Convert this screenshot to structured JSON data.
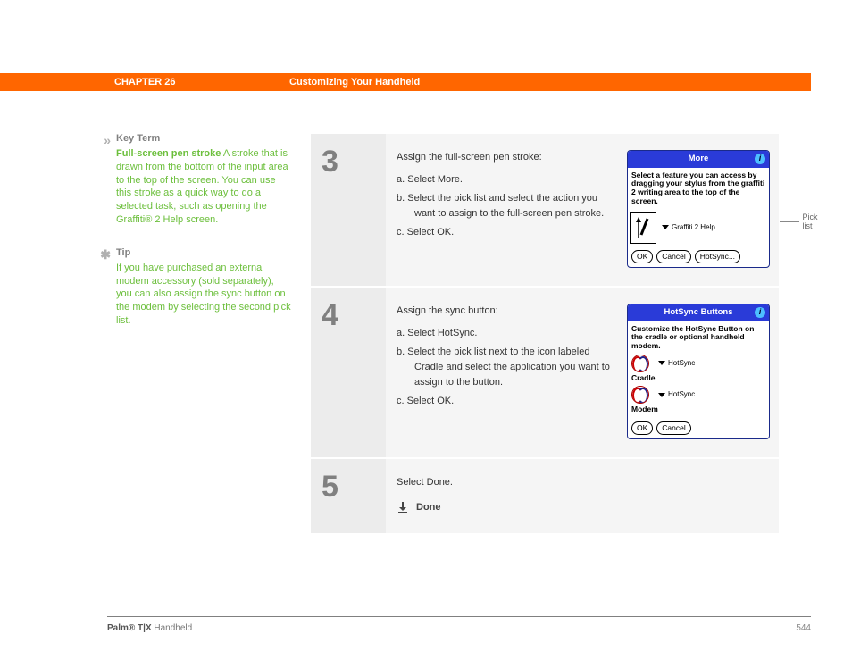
{
  "header": {
    "chapter": "CHAPTER 26",
    "title": "Customizing Your Handheld"
  },
  "sidebar": {
    "keyterm": {
      "label": "Key Term",
      "lead": "Full-screen pen stroke",
      "body": "A stroke that is drawn from the bottom of the input area to the top of the screen. You can use this stroke as a quick way to do a selected task, such as opening the Graffiti® 2 Help screen."
    },
    "tip": {
      "label": "Tip",
      "body": "If you have purchased an external modem accessory (sold separately), you can also assign the sync button on the modem by selecting the second pick list."
    }
  },
  "steps": {
    "s3": {
      "num": "3",
      "intro": "Assign the full-screen pen stroke:",
      "a": "a.   Select More.",
      "b": "b.   Select the pick list and select the action you want to assign to the full-screen pen stroke.",
      "c": "c.   Select OK."
    },
    "s4": {
      "num": "4",
      "intro": "Assign the sync button:",
      "a": "a.   Select HotSync.",
      "b": "b.   Select the pick list next to the icon labeled Cradle and select the application you want to assign to the button.",
      "c": "c.   Select OK."
    },
    "s5": {
      "num": "5",
      "intro": "Select Done.",
      "done": "Done"
    }
  },
  "screenshots": {
    "more": {
      "title": "More",
      "body": "Select a feature you can access by dragging your stylus from the graffiti 2 writing area to the top of the screen.",
      "pick": "Graffiti 2 Help",
      "ok": "OK",
      "cancel": "Cancel",
      "hotsync": "HotSync...",
      "callout": "Pick list"
    },
    "hotsync": {
      "title": "HotSync Buttons",
      "body": "Customize the HotSync Button on the cradle or optional handheld modem.",
      "cradle_label": "Cradle",
      "modem_label": "Modem",
      "pick": "HotSync",
      "ok": "OK",
      "cancel": "Cancel"
    }
  },
  "footer": {
    "product_bold": "Palm® T|X",
    "product_rest": " Handheld",
    "page": "544"
  }
}
